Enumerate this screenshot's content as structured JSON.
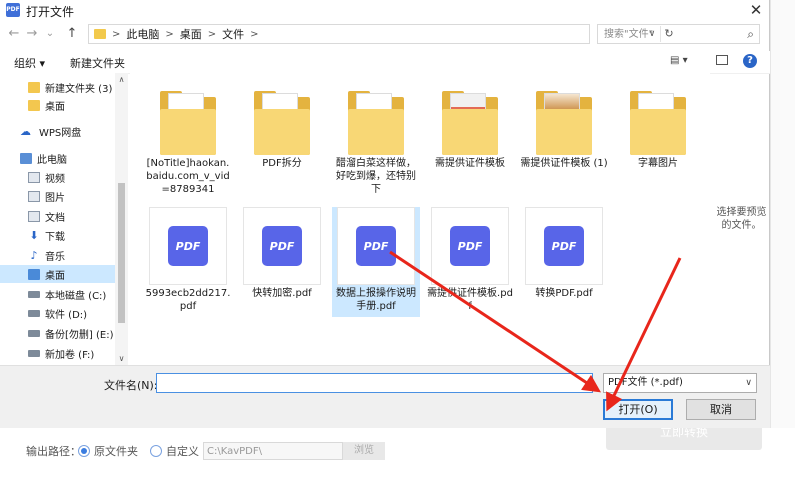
{
  "dialog": {
    "title": "打开文件",
    "app_icon_text": "PDF",
    "close_glyph": "✕"
  },
  "nav": {
    "back_glyph": "←",
    "forward_glyph": "→",
    "dropdown_glyph": "⌄",
    "up_glyph": "↑",
    "breadcrumbs": [
      "此电脑",
      "桌面",
      "文件"
    ],
    "crumb_sep": ">",
    "addr_dropdown_glyph": "∨",
    "refresh_glyph": "↻",
    "search_placeholder": "搜索\"文件\"",
    "search_icon": "⌕"
  },
  "toolbar": {
    "organize": "组织 ▾",
    "new_folder": "新建文件夹",
    "view_glyph": "▤ ▾",
    "help_glyph": "?"
  },
  "sidebar": {
    "items": [
      {
        "label": "新建文件夹 (3)",
        "icon": "folder-icon"
      },
      {
        "label": "桌面",
        "icon": "folder-icon"
      },
      {
        "label": "WPS网盘",
        "icon": "cloud-icon"
      },
      {
        "label": "此电脑",
        "icon": "computer-icon"
      },
      {
        "label": "视频",
        "icon": "video-icon"
      },
      {
        "label": "图片",
        "icon": "picture-icon"
      },
      {
        "label": "文档",
        "icon": "document-icon"
      },
      {
        "label": "下载",
        "icon": "download-icon"
      },
      {
        "label": "音乐",
        "icon": "music-icon"
      },
      {
        "label": "桌面",
        "icon": "desktop-icon"
      },
      {
        "label": "本地磁盘 (C:)",
        "icon": "drive-icon"
      },
      {
        "label": "软件 (D:)",
        "icon": "drive-icon"
      },
      {
        "label": "备份[勿删] (E:)",
        "icon": "drive-icon"
      },
      {
        "label": "新加卷 (F:)",
        "icon": "drive-icon"
      }
    ],
    "scroll_up": "∧",
    "scroll_down": "∨"
  },
  "files": {
    "folders": [
      {
        "label": "[NoTitle]haokan.baidu.com_v_vid=8789341"
      },
      {
        "label": "PDF拆分"
      },
      {
        "label": "醋溜白菜这样做，好吃到爆，还特别下"
      },
      {
        "label": "需提供证件模板"
      },
      {
        "label": "需提供证件模板 (1)"
      },
      {
        "label": "字幕图片"
      }
    ],
    "pdfs": [
      {
        "label": "5993ecb2dd217.pdf"
      },
      {
        "label": "快转加密.pdf"
      },
      {
        "label": "数据上报操作说明手册.pdf"
      },
      {
        "label": "需提供证件模板.pdf"
      },
      {
        "label": "转换PDF.pdf"
      }
    ],
    "pdf_badge_text": "PDF",
    "preview_text": "选择要预览的文件。"
  },
  "bottom": {
    "filename_label": "文件名(N):",
    "filename_value": "",
    "filter_value": "PDF文件 (*.pdf)",
    "filter_arrow": "∨",
    "open_label": "打开(O)",
    "cancel_label": "取消"
  },
  "background": {
    "output_label": "输出路径：",
    "option_source": "原文件夹",
    "option_custom": "自定义",
    "path_value": "C:\\KavPDF\\",
    "browse_label": "浏览",
    "convert_label": "立即转换"
  },
  "colors": {
    "accent": "#2a7ad6",
    "selection": "#cce8ff",
    "pdf_badge": "#5865e8",
    "annotation_arrow": "#e8261b"
  }
}
